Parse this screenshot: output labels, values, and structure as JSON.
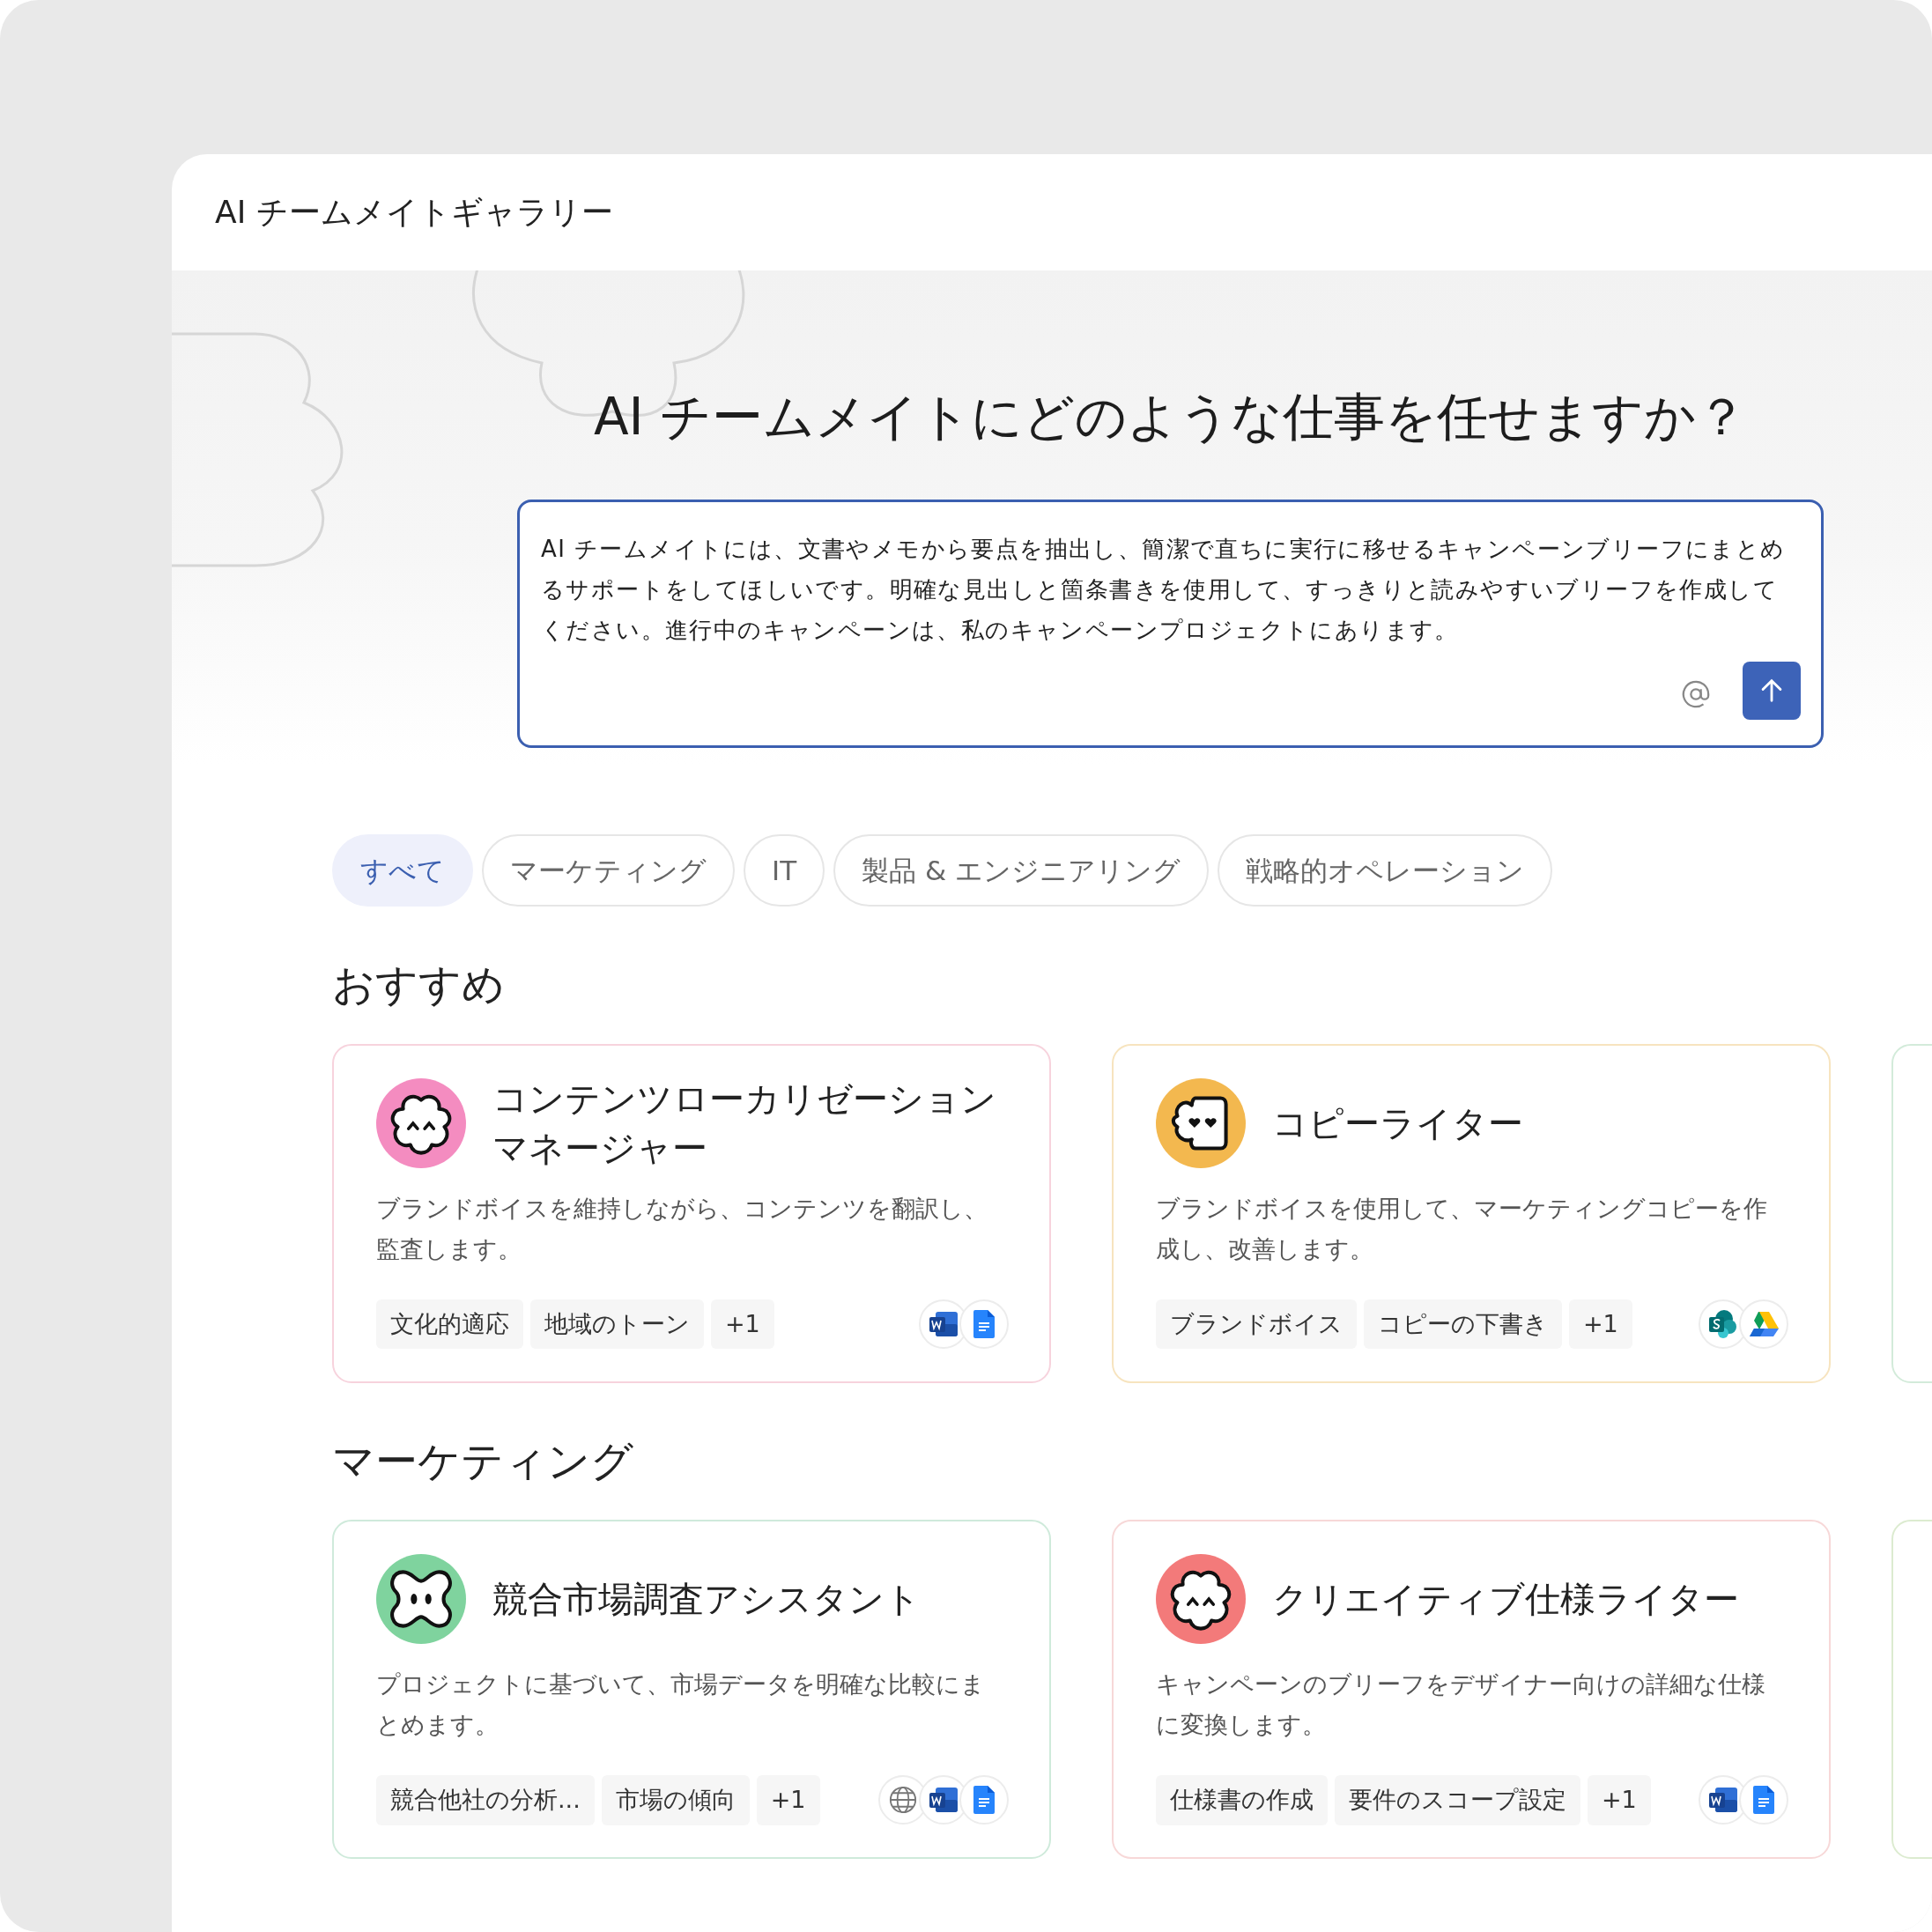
{
  "window": {
    "title": "AI チームメイトギャラリー"
  },
  "hero": {
    "heading": "AI チームメイトにどのような仕事を任せますか？",
    "prompt": {
      "value": "AI チームメイトには、文書やメモから要点を抽出し、簡潔で直ちに実行に移せるキャンペーンブリーフにまとめるサポートをしてほしいです。明確な見出しと箇条書きを使用して、すっきりと読みやすいブリーフを作成してください。進行中のキャンペーンは、私のキャンペーンプロジェクトにあります。"
    }
  },
  "tabs": [
    {
      "label": "すべて",
      "selected": true
    },
    {
      "label": "マーケティング",
      "selected": false
    },
    {
      "label": "IT",
      "selected": false
    },
    {
      "label": "製品 & エンジニアリング",
      "selected": false
    },
    {
      "label": "戦略的オペレーション",
      "selected": false
    }
  ],
  "sections": [
    {
      "title": "おすすめ",
      "cards": [
        {
          "kind": "card",
          "color": "#f7d3dd",
          "avatar": {
            "kind": "flower",
            "color": "#f48cc0"
          },
          "title": "コンテンツローカリゼーションマネージャー",
          "description": "ブランドボイスを維持しながら、コンテンツを翻訳し、監査します。",
          "tags": [
            "文化的適応",
            "地域のトーン",
            "+1"
          ],
          "apps": [
            {
              "kind": "word"
            },
            {
              "kind": "docs"
            }
          ]
        },
        {
          "kind": "card",
          "color": "#f7e4bf",
          "avatar": {
            "kind": "hearts",
            "color": "#f3b84f"
          },
          "title": "コピーライター",
          "description": "ブランドボイスを使用して、マーケティングコピーを作成し、改善します。",
          "tags": [
            "ブランドボイス",
            "コピーの下書き",
            "+1"
          ],
          "apps": [
            {
              "kind": "sharepoint"
            },
            {
              "kind": "drive"
            }
          ]
        },
        {
          "kind": "cut-off",
          "color": "#d3ebda"
        }
      ]
    },
    {
      "title": "マーケティング",
      "cards": [
        {
          "kind": "card",
          "color": "#cfeadb",
          "avatar": {
            "kind": "cross",
            "color": "#7fd39e"
          },
          "title": "競合市場調査アシスタント",
          "description": "プロジェクトに基づいて、市場データを明確な比較にまとめます。",
          "tags": [
            "競合他社の分析...",
            "市場の傾向",
            "+1"
          ],
          "apps": [
            {
              "kind": "globe"
            },
            {
              "kind": "word"
            },
            {
              "kind": "docs"
            }
          ]
        },
        {
          "kind": "card",
          "color": "#f7d8d8",
          "avatar": {
            "kind": "flower",
            "color": "#f37a7a"
          },
          "title": "クリエイティブ仕様ライター",
          "description": "キャンペーンのブリーフをデザイナー向けの詳細な仕様に変換します。",
          "tags": [
            "仕様書の作成",
            "要件のスコープ設定",
            "+1"
          ],
          "apps": [
            {
              "kind": "word"
            },
            {
              "kind": "docs"
            }
          ]
        },
        {
          "kind": "cut-off",
          "color": "#dcebd0"
        }
      ]
    }
  ]
}
